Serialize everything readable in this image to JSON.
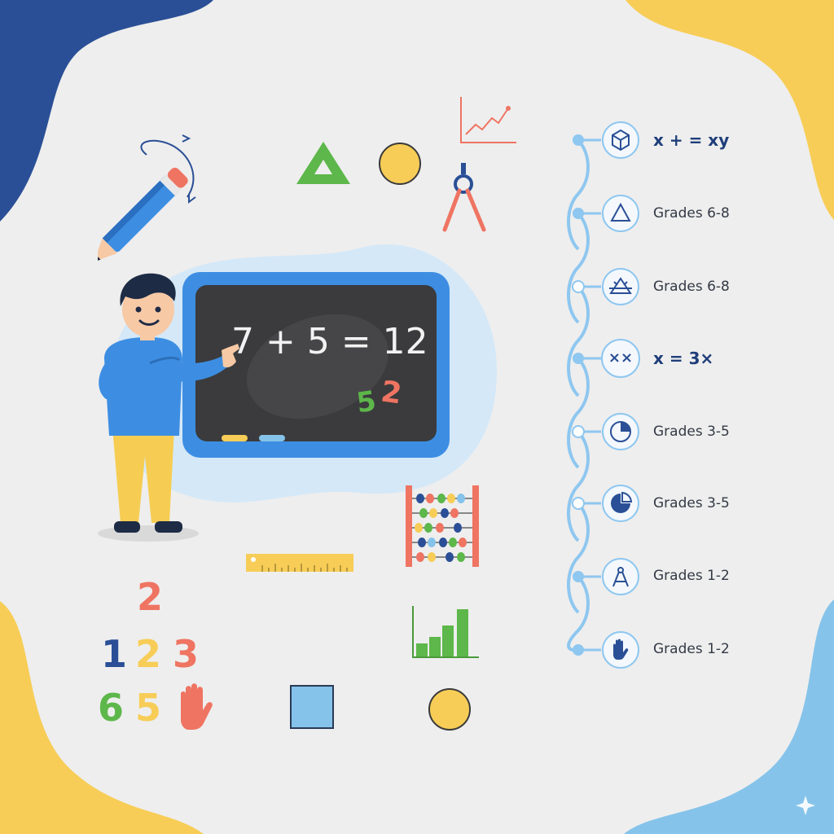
{
  "colors": {
    "background": "#eeeeee",
    "navy": "#2a4f96",
    "yellow": "#f7cd57",
    "light_blue": "#85c3ea",
    "chalkboard": "#3b3b3d",
    "board_frame": "#3d8ee2",
    "timeline": "#8ec7f0",
    "label_text": "#333a45",
    "math_text": "#1f3e7a",
    "green": "#5db74a",
    "coral": "#ef7462"
  },
  "chalkboard": {
    "equation": "7 + 5 = 12",
    "digit_green": "5",
    "digit_red": "2"
  },
  "timeline": {
    "items": [
      {
        "label": "x + = xy",
        "icon": "cube-icon"
      },
      {
        "label": "Grades 6-8",
        "icon": "triangle-icon"
      },
      {
        "label": "Grades 6-8",
        "icon": "geometry-angle-icon"
      },
      {
        "label": "x = 3×",
        "icon": "multiply-icon",
        "icon_text": "××"
      },
      {
        "label": "Grades 3-5",
        "icon": "pie-chart-icon"
      },
      {
        "label": "Grades 3-5",
        "icon": "pie-chart-icon"
      },
      {
        "label": "Grades 1-2",
        "icon": "compass-icon"
      },
      {
        "label": "Grades 1-2",
        "icon": "hand-icon"
      }
    ]
  },
  "numbers": {
    "top": "2",
    "row1": [
      "1",
      "2",
      "3"
    ],
    "row2": [
      "6",
      "5"
    ]
  }
}
